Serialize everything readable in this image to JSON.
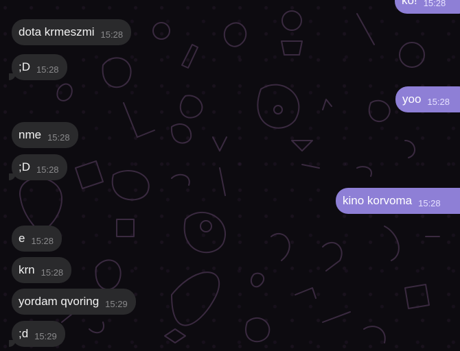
{
  "messages": [
    {
      "dir": "out",
      "text": "ko!",
      "time": "15:28"
    },
    {
      "dir": "in",
      "text": "dota krmeszmi",
      "time": "15:28"
    },
    {
      "dir": "in",
      "text": ";D",
      "time": "15:28"
    },
    {
      "dir": "out",
      "text": "yoo",
      "time": "15:28"
    },
    {
      "dir": "in",
      "text": "nme",
      "time": "15:28"
    },
    {
      "dir": "in",
      "text": ";D",
      "time": "15:28"
    },
    {
      "dir": "out",
      "text": "kino korvoma",
      "time": "15:28"
    },
    {
      "dir": "in",
      "text": "e",
      "time": "15:28"
    },
    {
      "dir": "in",
      "text": "krn",
      "time": "15:28"
    },
    {
      "dir": "in",
      "text": "yordam qvoring",
      "time": "15:29"
    },
    {
      "dir": "in",
      "text": ";d",
      "time": "15:29"
    }
  ],
  "colors": {
    "background": "#0d0b10",
    "incoming_bubble": "#2a2a2c",
    "outgoing_bubble": "#8e7fd6",
    "doodle_stroke": "#3a2a40"
  }
}
